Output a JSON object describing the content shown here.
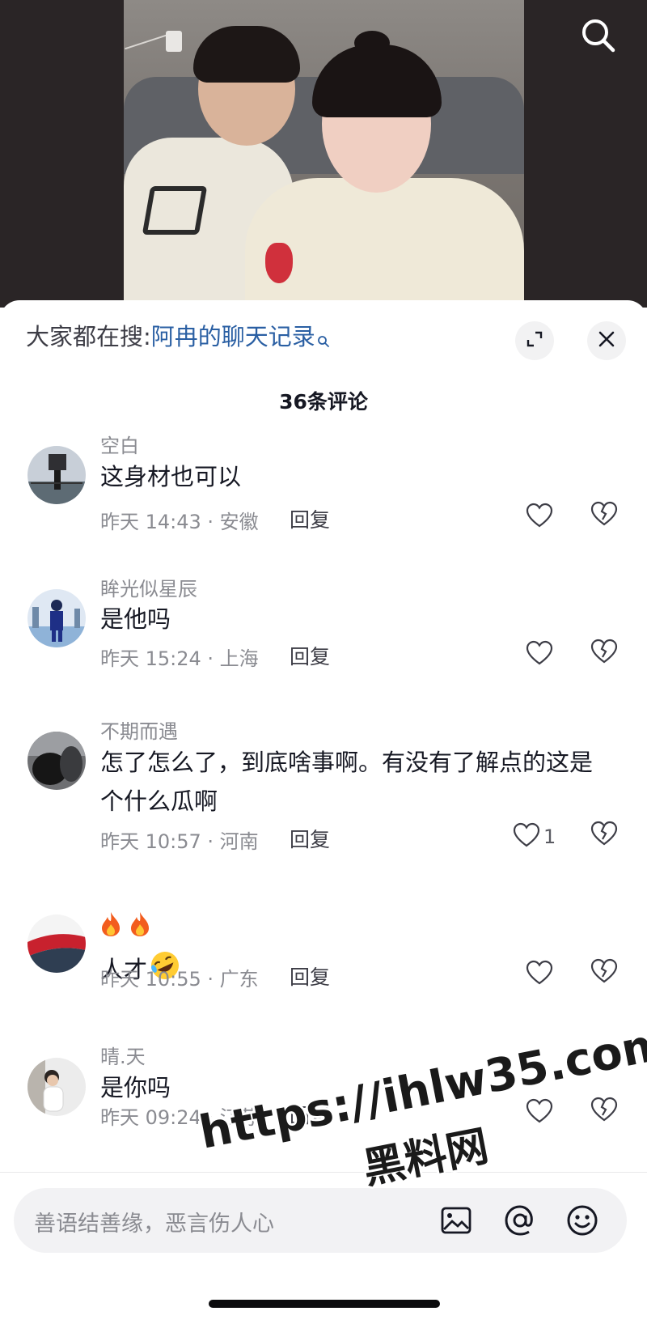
{
  "hot_search": {
    "prefix": "大家都在搜:",
    "query": "阿冉的聊天记录"
  },
  "comment_count": "36条评论",
  "comments": [
    {
      "username": "空白",
      "text": "这身材也可以",
      "meta": "昨天 14:43 · 安徽",
      "reply": "回复",
      "likes": ""
    },
    {
      "username": "眸光似星辰",
      "text": "是他吗",
      "meta": "昨天 15:24 · 上海",
      "reply": "回复",
      "likes": ""
    },
    {
      "username": "不期而遇",
      "text": "怎了怎么了，到底啥事啊。有没有了解点的这是个什么瓜啊",
      "meta": "昨天 10:57 · 河南",
      "reply": "回复",
      "likes": "1"
    },
    {
      "username": "",
      "text": "人才",
      "meta": "昨天 10:55 · 广东",
      "reply": "回复",
      "likes": ""
    },
    {
      "username": "晴.天",
      "text": "是你吗",
      "meta": "昨天 09:24 · 江苏",
      "reply": "回复",
      "likes": ""
    }
  ],
  "input": {
    "placeholder": "善语结善缘，恶言伤人心"
  },
  "watermark": {
    "url": "https://ihlw35.com",
    "name": "黑料网"
  },
  "icons": {
    "top_right": "search-icon",
    "hot_search": "magnifier-icon",
    "header": [
      "expand-icon",
      "close-icon"
    ],
    "comment_actions": [
      "heart-icon",
      "broken-heart-icon"
    ],
    "fire_emoji": "fire-icon",
    "laugh_emoji": "rolling-laughing-icon",
    "input_bar": [
      "image-icon",
      "at-icon",
      "emoji-icon"
    ]
  },
  "colors": {
    "link": "#2a5fa3",
    "secondary_text": "#8a8b91",
    "primary_text": "#161823"
  }
}
